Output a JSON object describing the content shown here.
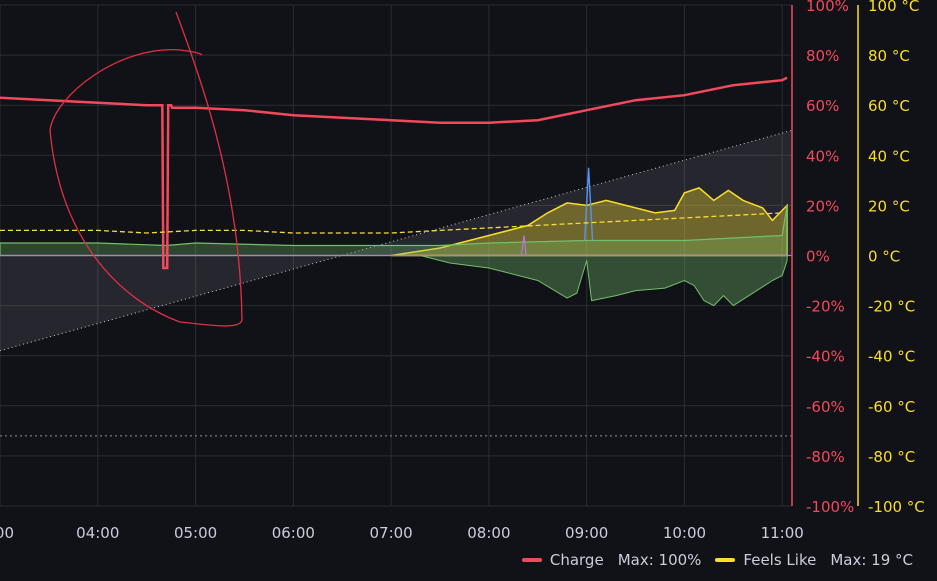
{
  "chart_data": {
    "type": "line",
    "x_ticks": [
      "00",
      "04:00",
      "05:00",
      "06:00",
      "07:00",
      "08:00",
      "09:00",
      "10:00",
      "11:00"
    ],
    "x_hours": [
      3.0,
      4.0,
      5.0,
      6.0,
      7.0,
      8.0,
      9.0,
      10.0,
      11.0
    ],
    "xlim": [
      3.0,
      11.1
    ],
    "left_axis": {
      "ticks": [
        "100%",
        "80%",
        "60%",
        "40%",
        "20%",
        "0%",
        "-20%",
        "-40%",
        "-60%",
        "-80%",
        "-100%"
      ],
      "ylim": [
        -100,
        100
      ],
      "color": "#f2495c"
    },
    "right_axis": {
      "ticks": [
        "100 °C",
        "80 °C",
        "60 °C",
        "40 °C",
        "20 °C",
        "0 °C",
        "-20 °C",
        "-40 °C",
        "-60 °C",
        "-80 °C",
        "-100 °C"
      ],
      "ylim": [
        -100,
        100
      ],
      "color": "#fade2a"
    },
    "grid": true,
    "series": [
      {
        "name": "Charge",
        "color": "#f2495c",
        "x": [
          3.0,
          3.5,
          4.0,
          4.5,
          4.66,
          4.67,
          4.69,
          4.71,
          4.72,
          4.75,
          4.76,
          5.0,
          5.5,
          6.0,
          6.5,
          7.0,
          7.5,
          8.0,
          8.5,
          9.0,
          9.5,
          10.0,
          10.5,
          11.0,
          11.05
        ],
        "values": [
          63,
          62,
          61,
          60,
          60,
          -5,
          -5,
          -5,
          60,
          60,
          59,
          59,
          58,
          56,
          55,
          54,
          53,
          53,
          54,
          58,
          62,
          64,
          68,
          70,
          71
        ],
        "legend_stat": "Max: 100%"
      },
      {
        "name": "Feels Like",
        "color": "#fade2a",
        "x": [
          3.0,
          3.5,
          4.0,
          4.5,
          5.0,
          5.5,
          6.0,
          6.5,
          7.0,
          7.5,
          8.0,
          8.5,
          9.0,
          9.5,
          10.0,
          10.5,
          11.0
        ],
        "values": [
          10,
          10,
          10,
          9,
          10,
          10,
          9,
          9,
          9,
          10,
          11,
          12,
          13,
          14,
          15,
          16,
          17
        ],
        "legend_stat": "Max: 19 °C"
      }
    ]
  },
  "legend": {
    "items": [
      {
        "label": "Charge",
        "stat": "Max: 100%",
        "color": "#f2495c"
      },
      {
        "label": "Feels Like",
        "stat": "Max: 19 °C",
        "color": "#fade2a"
      }
    ]
  }
}
